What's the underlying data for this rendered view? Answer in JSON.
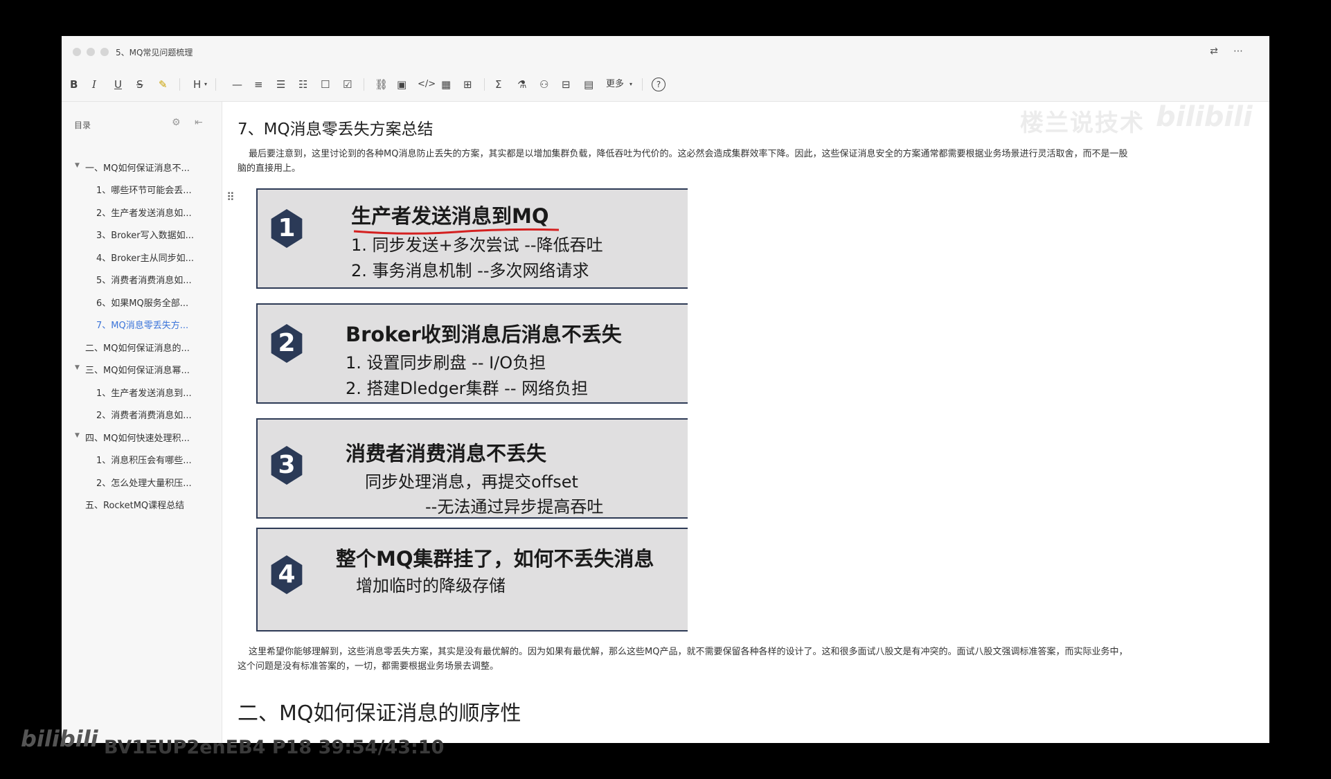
{
  "window": {
    "title": "5、MQ常见问题梳理"
  },
  "toolbar": {
    "bold": "B",
    "italic": "I",
    "underline": "U",
    "strike": "S",
    "heading": "H",
    "more": "更多",
    "help": "?"
  },
  "watermark": {
    "text": "楼兰说技术",
    "brand": "bilibili"
  },
  "sidebar": {
    "title": "目录",
    "items": [
      {
        "label": "一、MQ如何保证消息不...",
        "level": 1,
        "expanded": true
      },
      {
        "label": "1、哪些环节可能会丢...",
        "level": 2
      },
      {
        "label": "2、生产者发送消息如...",
        "level": 2
      },
      {
        "label": "3、Broker写入数据如...",
        "level": 2
      },
      {
        "label": "4、Broker主从同步如...",
        "level": 2
      },
      {
        "label": "5、消费者消费消息如...",
        "level": 2
      },
      {
        "label": "6、如果MQ服务全部...",
        "level": 2
      },
      {
        "label": "7、MQ消息零丢失方...",
        "level": 2,
        "active": true
      },
      {
        "label": "二、MQ如何保证消息的...",
        "level": 1
      },
      {
        "label": "三、MQ如何保证消息幂...",
        "level": 1,
        "expanded": true
      },
      {
        "label": "1、生产者发送消息到...",
        "level": 2
      },
      {
        "label": "2、消费者消费消息如...",
        "level": 2
      },
      {
        "label": "四、MQ如何快速处理积...",
        "level": 1,
        "expanded": true
      },
      {
        "label": "1、消息积压会有哪些...",
        "level": 2
      },
      {
        "label": "2、怎么处理大量积压...",
        "level": 2
      },
      {
        "label": "五、RocketMQ课程总结",
        "level": 1
      }
    ]
  },
  "content": {
    "heading": "7、MQ消息零丢失方案总结",
    "intro_line1": "最后要注意到，这里讨论到的各种MQ消息防止丢失的方案，其实都是以增加集群负载，降低吞吐为代价的。这必然会造成集群效率下降。因此，这些保证消息安全的方案通常都需要根据业务场景进行灵活取舍，而不是一股",
    "intro_line2": "脑的直接用上。",
    "cards": [
      {
        "num": "1",
        "title": "生产者发送消息到MQ",
        "lines": [
          "1.      同步发送+多次尝试  --降低吞吐",
          "2.      事务消息机制  --多次网络请求"
        ]
      },
      {
        "num": "2",
        "title": "Broker收到消息后消息不丢失",
        "lines": [
          "1.      设置同步刷盘 -- I/O负担",
          "2.      搭建Dledger集群 -- 网络负担"
        ]
      },
      {
        "num": "3",
        "title": "消费者消费消息不丢失",
        "lines": [
          "同步处理消息，再提交offset",
          "--无法通过异步提高吞吐"
        ]
      },
      {
        "num": "4",
        "title": "整个MQ集群挂了，如何不丢失消息",
        "lines": [
          "增加临时的降级存储"
        ]
      }
    ],
    "outro_line1": "这里希望你能够理解到，这些消息零丢失方案，其实是没有最优解的。因为如果有最优解，那么这些MQ产品，就不需要保留各种各样的设计了。这和很多面试八股文是有冲突的。面试八股文强调标准答案，而实际业务中，",
    "outro_line2": "这个问题是没有标准答案的，一切，都需要根据业务场景去调整。",
    "next_heading": "二、MQ如何保证消息的顺序性"
  },
  "overlay": {
    "logo": "bilibili",
    "video_id": "BV1EUP2enEB4 P18 39:54/43:10"
  }
}
